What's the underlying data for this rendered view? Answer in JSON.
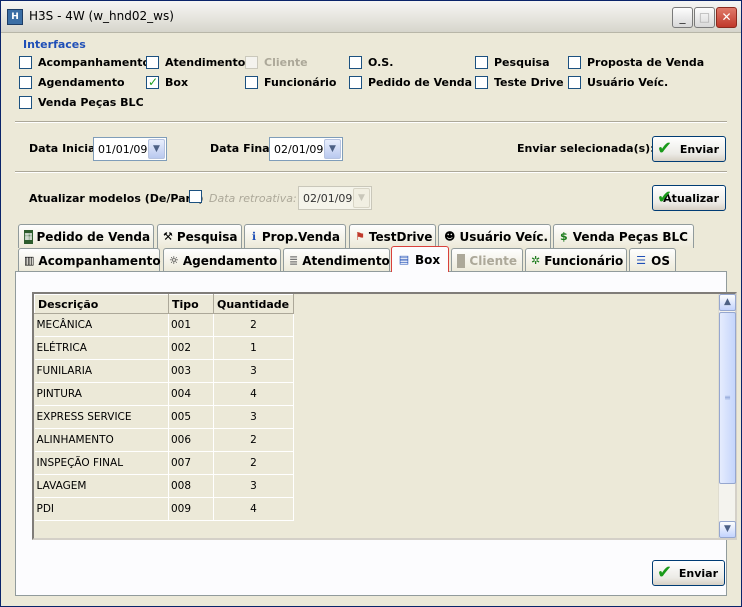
{
  "window": {
    "title": "H3S - 4W (w_hnd02_ws)",
    "icon": "app-icon"
  },
  "interfaces": {
    "label": "Interfaces",
    "items": [
      {
        "label": "Acompanhamento",
        "checked": false,
        "enabled": true
      },
      {
        "label": "Atendimento",
        "checked": false,
        "enabled": true
      },
      {
        "label": "Cliente",
        "checked": false,
        "enabled": false
      },
      {
        "label": "O.S.",
        "checked": false,
        "enabled": true
      },
      {
        "label": "Pesquisa",
        "checked": false,
        "enabled": true
      },
      {
        "label": "Proposta de Venda",
        "checked": false,
        "enabled": true
      },
      {
        "label": "Agendamento",
        "checked": false,
        "enabled": true
      },
      {
        "label": "Box",
        "checked": true,
        "enabled": true
      },
      {
        "label": "Funcionário",
        "checked": false,
        "enabled": true
      },
      {
        "label": "Pedido de Venda",
        "checked": false,
        "enabled": true
      },
      {
        "label": "Teste Drive",
        "checked": false,
        "enabled": true
      },
      {
        "label": "Usuário Veíc.",
        "checked": false,
        "enabled": true
      },
      {
        "label": "Venda Peças BLC",
        "checked": false,
        "enabled": true
      }
    ]
  },
  "dates": {
    "start_label": "Data Inicial:",
    "start_value": "01/01/09",
    "end_label": "Data Final:",
    "end_value": "02/01/09",
    "send_label": "Enviar selecionada(s):",
    "send_button": "Enviar"
  },
  "models": {
    "label": "Atualizar modelos (De/Para)",
    "retro_label": "Data retroativa:",
    "retro_value": "02/01/09",
    "update_button": "Atualizar"
  },
  "tabs_row1": [
    {
      "label": "Pedido de Venda",
      "icon": "table-icon"
    },
    {
      "label": "Pesquisa",
      "icon": "search-tool-icon"
    },
    {
      "label": "Prop.Venda",
      "icon": "info-icon"
    },
    {
      "label": "TestDrive",
      "icon": "flag-icon"
    },
    {
      "label": "Usuário Veíc.",
      "icon": "user-icon"
    },
    {
      "label": "Venda Peças BLC",
      "icon": "dollar-icon"
    }
  ],
  "tabs_row2": [
    {
      "label": "Acompanhamento",
      "icon": "film-icon"
    },
    {
      "label": "Agendamento",
      "icon": "calendar-icon"
    },
    {
      "label": "Atendimento",
      "icon": "database-icon"
    },
    {
      "label": "Box",
      "icon": "window-icon",
      "active": true
    },
    {
      "label": "Cliente",
      "icon": "square-icon",
      "disabled": true
    },
    {
      "label": "Funcionário",
      "icon": "network-icon"
    },
    {
      "label": "OS",
      "icon": "list-icon"
    }
  ],
  "table": {
    "columns": [
      "Descrição",
      "Tipo",
      "Quantidade"
    ],
    "rows": [
      [
        "MECÂNICA",
        "001",
        "2"
      ],
      [
        "ELÉTRICA",
        "002",
        "1"
      ],
      [
        "FUNILARIA",
        "003",
        "3"
      ],
      [
        "PINTURA",
        "004",
        "4"
      ],
      [
        "EXPRESS SERVICE",
        "005",
        "3"
      ],
      [
        "ALINHAMENTO",
        "006",
        "2"
      ],
      [
        "INSPEÇÃO FINAL",
        "007",
        "2"
      ],
      [
        "LAVAGEM",
        "008",
        "3"
      ],
      [
        "PDI",
        "009",
        "4"
      ]
    ]
  },
  "footer": {
    "send_button": "Enviar"
  },
  "colors": {
    "group_label": "#1f4fb7",
    "active_tab_border": "#d9413b",
    "check_green": "#1a9a1a"
  }
}
